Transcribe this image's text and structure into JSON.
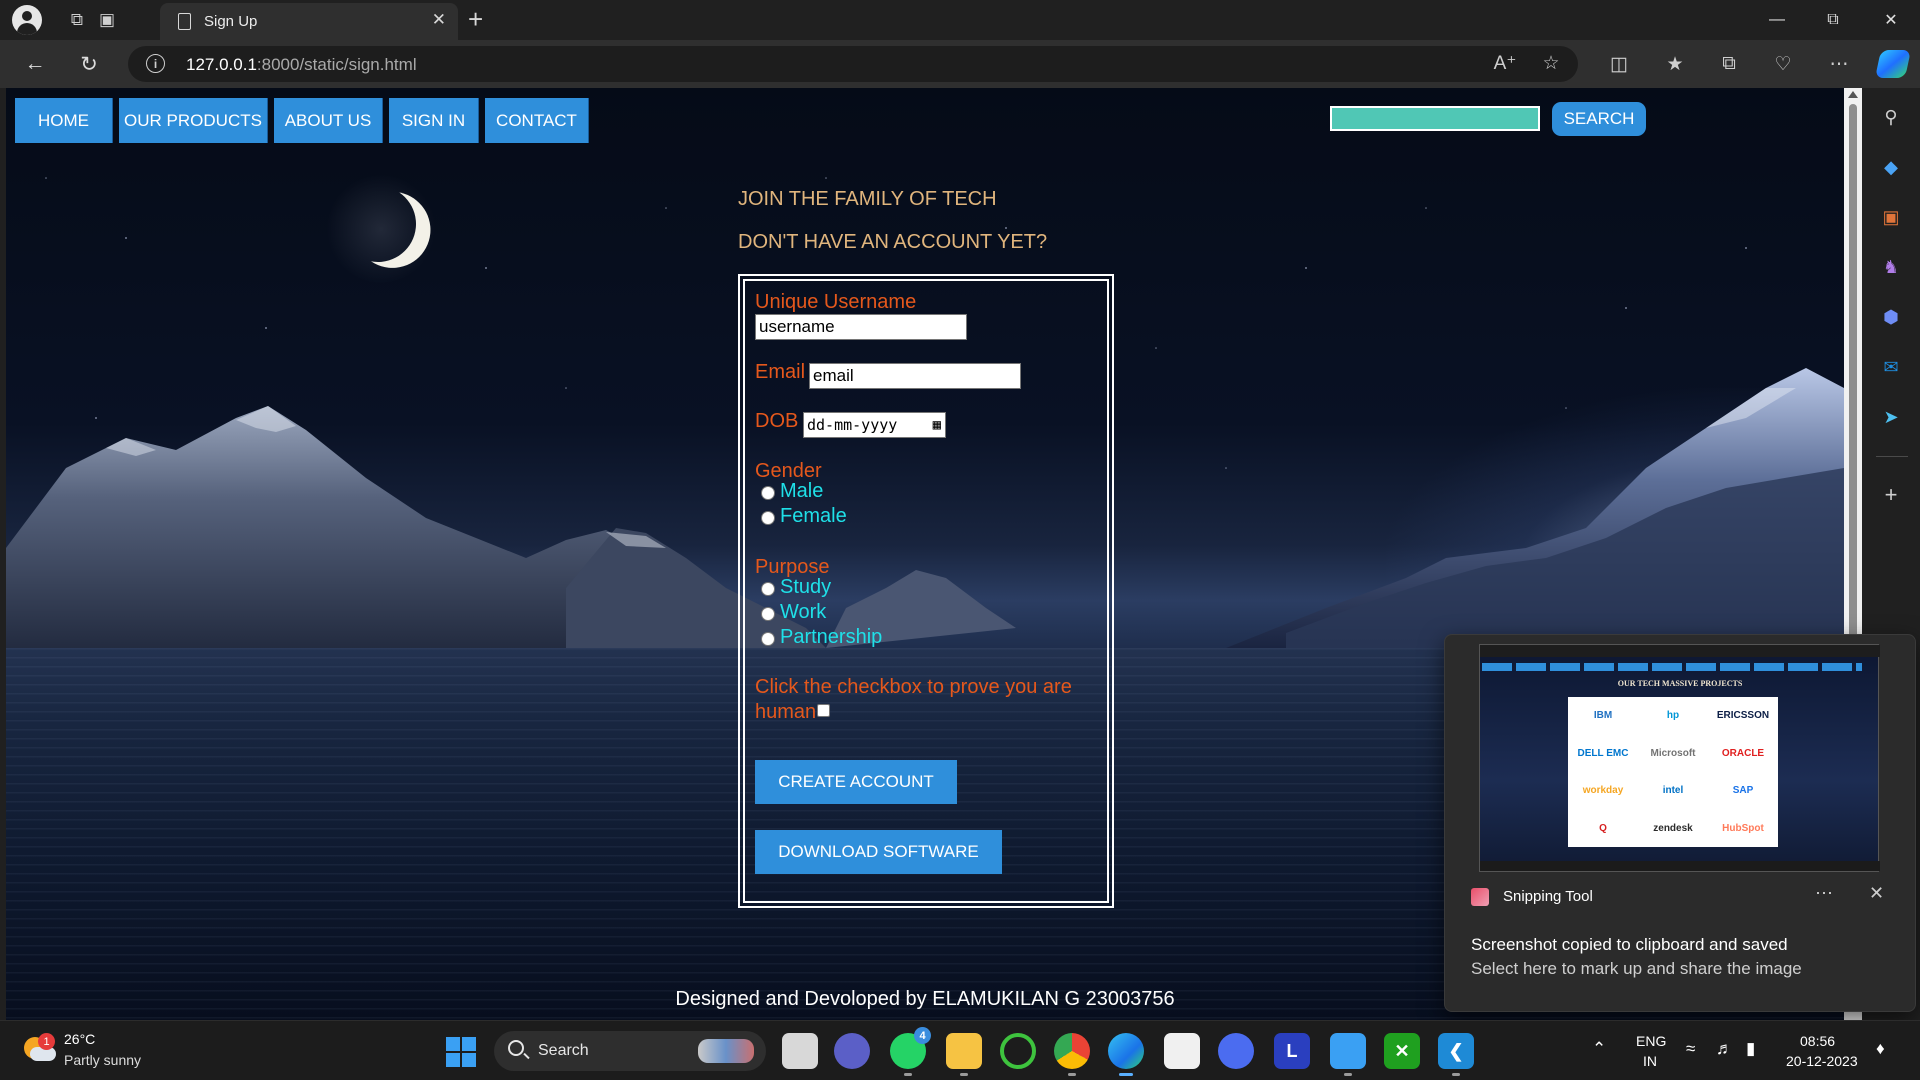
{
  "browser": {
    "tab_title": "Sign Up",
    "url_host": "127.0.0.1",
    "url_rest": ":8000/static/sign.html"
  },
  "site": {
    "nav": [
      "HOME",
      "OUR PRODUCTS",
      "ABOUT US",
      "SIGN IN",
      "CONTACT"
    ],
    "search_button": "SEARCH",
    "heading1": "JOIN THE FAMILY OF TECH",
    "heading2": "DON'T HAVE AN ACCOUNT YET?"
  },
  "form": {
    "username_label": "Unique Username",
    "username_value": "username",
    "email_label": "Email",
    "email_value": "email",
    "dob_label": "DOB",
    "dob_placeholder": "dd-mm-yyyy",
    "gender_label": "Gender",
    "gender_options": [
      "Male",
      "Female"
    ],
    "purpose_label": "Purpose",
    "purpose_options": [
      "Study",
      "Work",
      "Partnership"
    ],
    "captcha_line1": "Click the checkbox to prove you are",
    "captcha_line2": "human",
    "create_button": "CREATE ACCOUNT",
    "download_button": "DOWNLOAD SOFTWARE"
  },
  "footer": "Designed and Devoloped by ELAMUKILAN G 23003756",
  "toast": {
    "app_name": "Snipping Tool",
    "message": "Screenshot copied to clipboard and saved",
    "sub_message": "Select here to mark up and share the image",
    "thumb_title": "OUR TECH MASSIVE PROJECTS",
    "thumb_logos": [
      "IBM",
      "hp",
      "ERICSSON",
      "DELL EMC",
      "Microsoft",
      "ORACLE",
      "workday",
      "intel",
      "SAP",
      "Q",
      "zendesk",
      "HubSpot"
    ]
  },
  "taskbar": {
    "weather_temp": "26°C",
    "weather_desc": "Partly sunny",
    "weather_badge": "1",
    "search_label": "Search",
    "whatsapp_badge": "4",
    "lang1": "ENG",
    "lang2": "IN",
    "time": "08:56",
    "date": "20-12-2023"
  },
  "colors": {
    "nav_blue": "#2f8fdb",
    "label_orange": "#e5581c",
    "option_cyan": "#1fe0e8",
    "heading_tan": "#e0b57d",
    "search_teal": "#50c7b5"
  }
}
